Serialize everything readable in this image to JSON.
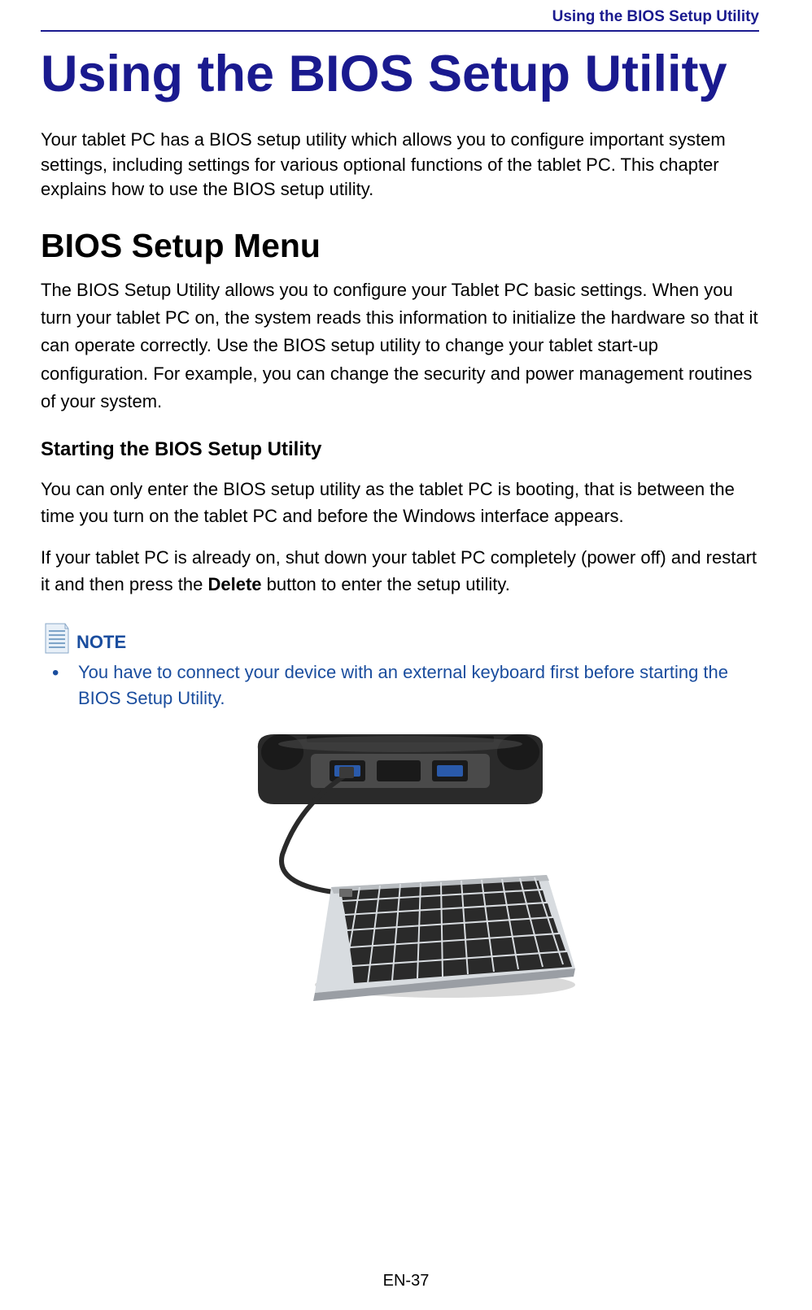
{
  "header": {
    "running_title": "Using the BIOS Setup Utility"
  },
  "title": "Using the BIOS Setup Utility",
  "intro": "Your tablet PC has a BIOS setup utility which allows you to configure important system settings, including settings for various optional functions of the tablet PC. This chapter explains how to use the BIOS setup utility.",
  "section1": {
    "heading": "BIOS Setup Menu",
    "body": "The BIOS Setup Utility allows you to configure your Tablet PC basic settings. When you turn your tablet PC on, the system reads this information to initialize the hardware so that it can operate correctly. Use the BIOS setup utility to change your tablet start-up configuration. For example, you can change the security and power management routines of your system."
  },
  "subsection1": {
    "heading": "Starting the BIOS Setup Utility",
    "p1": "You can only enter the BIOS setup utility as the tablet PC is booting, that is between the time you turn on the tablet PC and before the Windows interface appears.",
    "p2_prefix": "If your tablet PC is already on, shut down your tablet PC completely (power off) and restart it and then press the ",
    "p2_bold": "Delete",
    "p2_suffix": " button to enter the setup utility."
  },
  "note": {
    "label": "NOTE",
    "items": [
      "You have to connect your device with an external keyboard first before starting the BIOS Setup Utility."
    ]
  },
  "image": {
    "alt": "Tablet PC device connected to an external keyboard via cable"
  },
  "footer": {
    "page_label": "EN-37"
  }
}
